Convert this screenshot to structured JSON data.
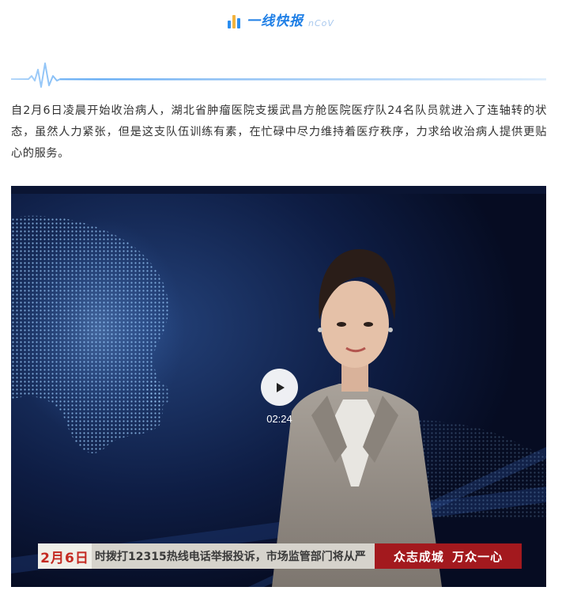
{
  "header": {
    "title": "一线快报",
    "subtitle": "nCoV",
    "bar_colors": [
      "#2b8ef0",
      "#f2b33d",
      "#2b8ef0"
    ],
    "accent_color": "#1f7fe6"
  },
  "article": {
    "paragraph": "自2月6日凌晨开始收治病人，湖北省肿瘤医院支援武昌方舱医院医疗队24名队员就进入了连轴转的状态，虽然人力紧张，但是这支队伍训练有素，在忙碌中尽力维持着医疗秩序，力求给收治病人提供更贴心的服务。"
  },
  "video": {
    "duration": "02:24",
    "play_icon": "play-icon",
    "overlay": {
      "date": "2月6日",
      "ticker": "时拨打12315热线电话举报投诉，市场监管部门将从严",
      "slogan": "众志成城 万众一心",
      "slogan_color": "#a3191e",
      "date_color": "#c42a22"
    }
  }
}
